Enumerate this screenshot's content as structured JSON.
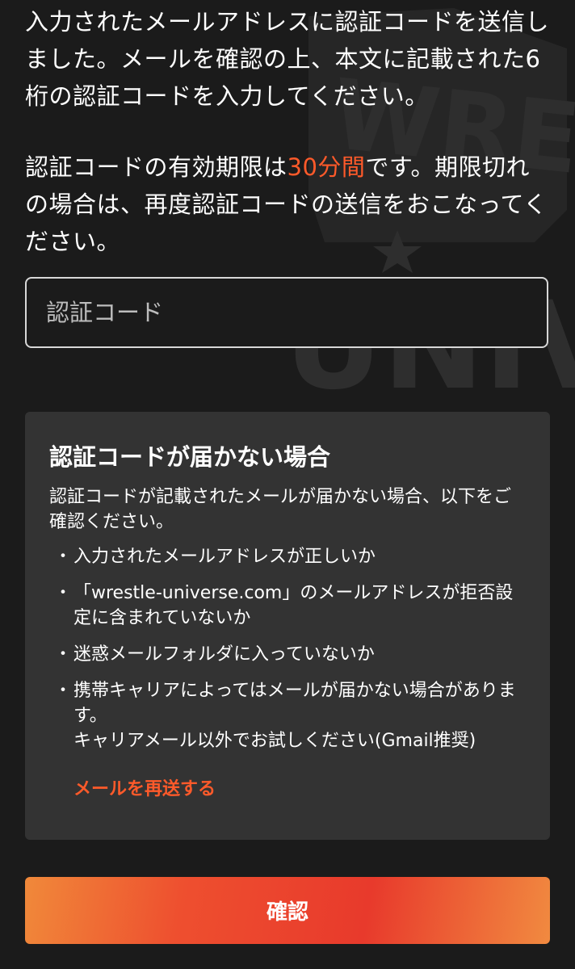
{
  "intro": {
    "paragraph1": "入力されたメールアドレスに認証コードを送信しました。メールを確認の上、本文に記載された6桁の認証コードを入力してください。",
    "paragraph2_before": "認証コードの有効期限は",
    "paragraph2_highlight": "30分間",
    "paragraph2_after": "です。期限切れの場合は、再度認証コードの送信をおこなってください。"
  },
  "code_input": {
    "placeholder": "認証コード",
    "value": ""
  },
  "help": {
    "title": "認証コードが届かない場合",
    "description": "認証コードが記載されたメールが届かない場合、以下をご確認ください。",
    "bullet_symbol": "・",
    "items": [
      "入力されたメールアドレスが正しいか",
      "「wrestle-universe.com」のメールアドレスが拒否設定に含まれていないか",
      "迷惑メールフォルダに入っていないか",
      "携帯キャリアによってはメールが届かない場合があります。\nキャリアメール以外でお試しください(Gmail推奨)"
    ],
    "resend_label": "メールを再送する"
  },
  "confirm_button": {
    "label": "確認"
  },
  "colors": {
    "background": "#1b1b1b",
    "panel": "#333333",
    "accent": "#ff5a2a",
    "button_gradient_start": "#f0893a",
    "button_gradient_end": "#e83a2c"
  }
}
